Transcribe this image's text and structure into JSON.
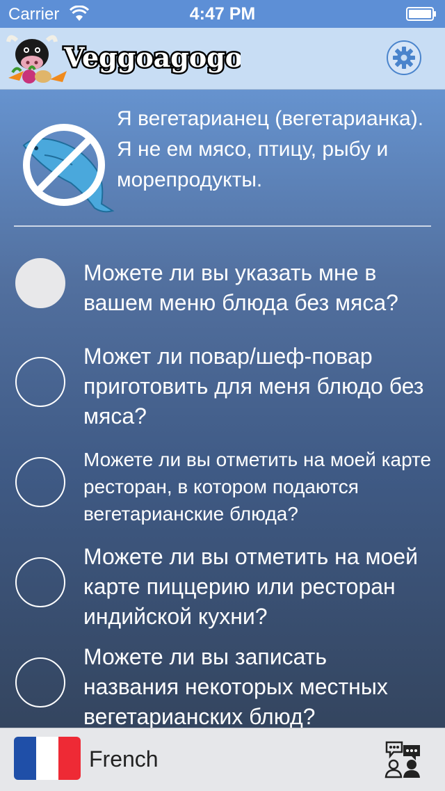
{
  "status_bar": {
    "carrier": "Carrier",
    "time": "4:47 PM"
  },
  "header": {
    "app_name": "Veggoagogo",
    "settings_icon": "gear-icon"
  },
  "statement": {
    "icon": "no-fish-icon",
    "text": "Я вегетарианец (вегетарианка). Я не ем мясо, птицу, рыбу и морепродукты."
  },
  "questions": [
    {
      "text": "Можете ли вы указать мне в вашем меню блюда без мяса?",
      "selected": true
    },
    {
      "text": "Может ли повар/шеф-повар приготовить для меня блюдо без мяса?",
      "selected": false
    },
    {
      "text": "Можете ли вы отметить на моей карте ресторан, в котором подаются вегетарианские блюда?",
      "selected": false
    },
    {
      "text": "Можете ли вы отметить на моей карте пиццерию или ресторан индийской кухни?",
      "selected": false
    },
    {
      "text": "Можете ли вы записать названия некоторых местных вегетарианских блюд?",
      "selected": false
    }
  ],
  "bottom_bar": {
    "language": "French",
    "flag_colors": [
      "#1f4fa8",
      "#ffffff",
      "#ee2a35"
    ],
    "chat_icon": "chat-users-icon"
  },
  "colors": {
    "header_bg": "#c8ddf4",
    "accent_blue": "#4a84cc",
    "status_bar_bg": "#5d8fd6"
  }
}
